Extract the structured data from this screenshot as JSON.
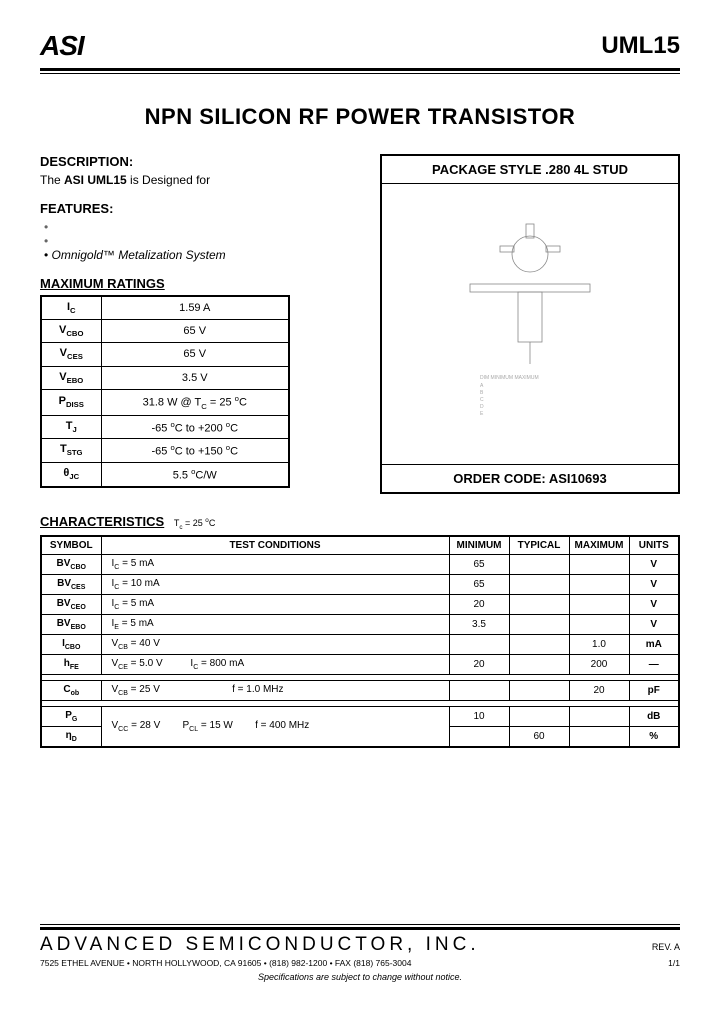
{
  "header": {
    "logo": "ASI",
    "part_number": "UML15"
  },
  "title": "NPN SILICON RF POWER TRANSISTOR",
  "description": {
    "heading": "DESCRIPTION:",
    "text_prefix": "The ",
    "text_bold": "ASI UML15",
    "text_suffix": " is Designed for"
  },
  "features": {
    "heading": "FEATURES:",
    "items": [
      "",
      "",
      "Omnigold™ Metalization System"
    ]
  },
  "max_ratings": {
    "heading": "MAXIMUM RATINGS",
    "rows": [
      {
        "sym": "I_C",
        "val": "1.59 A"
      },
      {
        "sym": "V_CBO",
        "val": "65 V"
      },
      {
        "sym": "V_CES",
        "val": "65 V"
      },
      {
        "sym": "V_EBO",
        "val": "3.5 V"
      },
      {
        "sym": "P_DISS",
        "val": "31.8 W @ T_C = 25 °C"
      },
      {
        "sym": "T_J",
        "val": "-65 °C to +200 °C"
      },
      {
        "sym": "T_STG",
        "val": "-65 °C to +150 °C"
      },
      {
        "sym": "θ_JC",
        "val": "5.5 °C/W"
      }
    ]
  },
  "package": {
    "title": "PACKAGE  STYLE  .280 4L STUD",
    "drawing_placeholder": "[ package outline drawing ]",
    "order_code_label": "ORDER CODE: ",
    "order_code": "ASI10693"
  },
  "characteristics": {
    "heading": "CHARACTERISTICS",
    "condition_note": "T_c = 25 °C",
    "columns": [
      "SYMBOL",
      "TEST CONDITIONS",
      "MINIMUM",
      "TYPICAL",
      "MAXIMUM",
      "UNITS"
    ],
    "rows": [
      {
        "sym": "BV_CBO",
        "cond": "I_C = 5 mA",
        "min": "65",
        "typ": "",
        "max": "",
        "unit": "V"
      },
      {
        "sym": "BV_CES",
        "cond": "I_C = 10 mA",
        "min": "65",
        "typ": "",
        "max": "",
        "unit": "V"
      },
      {
        "sym": "BV_CEO",
        "cond": "I_C = 5 mA",
        "min": "20",
        "typ": "",
        "max": "",
        "unit": "V"
      },
      {
        "sym": "BV_EBO",
        "cond": "I_E = 5 mA",
        "min": "3.5",
        "typ": "",
        "max": "",
        "unit": "V"
      },
      {
        "sym": "I_CBO",
        "cond": "V_CB = 40 V",
        "min": "",
        "typ": "",
        "max": "1.0",
        "unit": "mA"
      },
      {
        "sym": "h_FE",
        "cond": "V_CE = 5.0 V          I_C = 800 mA",
        "min": "20",
        "typ": "",
        "max": "200",
        "unit": "—"
      }
    ],
    "rows2": [
      {
        "sym": "C_ob",
        "cond": "V_CB = 25 V                         f = 1.0 MHz",
        "min": "",
        "typ": "",
        "max": "20",
        "unit": "pF"
      }
    ],
    "rows3": [
      {
        "sym": "P_G",
        "cond": "V_CC = 28 V        P_CL = 15 W        f = 400 MHz",
        "min": "10",
        "typ": "",
        "max": "",
        "unit": "dB"
      },
      {
        "sym": "η_D",
        "cond": "",
        "min": "",
        "typ": "60",
        "max": "",
        "unit": "%"
      }
    ]
  },
  "footer": {
    "company": "ADVANCED SEMICONDUCTOR, INC.",
    "rev": "REV. A",
    "address": "7525 ETHEL AVENUE • NORTH HOLLYWOOD, CA 91605 • (818) 982-1200 • FAX (818) 765-3004",
    "page": "1/1",
    "disclaimer": "Specifications are subject to change without notice."
  }
}
